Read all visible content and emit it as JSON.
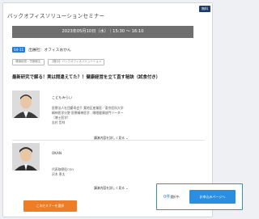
{
  "header": {
    "title": "バックオフィスソリューションセミナー",
    "badge": "無料"
  },
  "session": {
    "date_time": "2023年05月10日（水）｜15:30 〜 16:10",
    "category": "S4-11",
    "host": "出展社：オフィスおかん",
    "tags": [
      "健康経営・労働衛生",
      "【展示】バックオフィスソリューション"
    ],
    "title": "最新研究で解る！実は間違えてた？！健康経営を立て直す秘訣（試食付き）"
  },
  "speakers": [
    {
      "name": "こどもみらい",
      "lines": [
        "医療法人社団慶寿会千 葉地区産業医／東京医科大学",
        "精神医学分野 医療精神医学 - 睡眠健康部門リーダー",
        "（博士医学）",
        "志村 哲祥"
      ],
      "more": "講演内容を詳しく見る"
    },
    {
      "name": "OKAN",
      "lines": [
        "代表取締役CEO",
        "沢木 恵太"
      ],
      "more": "講演内容を詳しく見る"
    }
  ],
  "actions": {
    "select_label": "このセミナーを選択"
  },
  "bottom_bar": {
    "count": "0件",
    "count_suffix": "選択中",
    "apply_label": "お申込みページへ"
  },
  "colors": {
    "accent_blue": "#2a8fe0",
    "accent_orange": "#ef7d25",
    "badge_navy": "#1d3a6b",
    "date_bar": "#6f6f6f"
  }
}
